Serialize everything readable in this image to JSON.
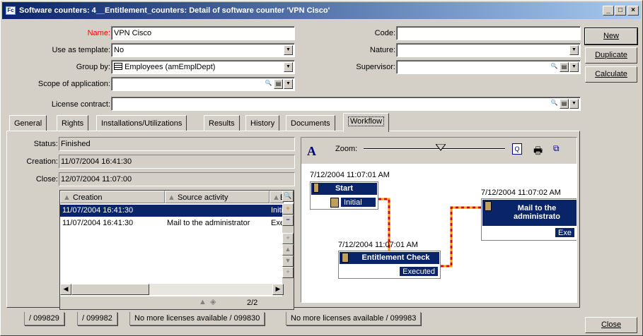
{
  "window": {
    "title": "Software counters: 4__Entitlement_counters: Detail of software counter 'VPN Cisco'",
    "app_icon": "Fc",
    "controls": [
      "_",
      "□",
      "×"
    ]
  },
  "form": {
    "name_label": "Name:",
    "name_value": "VPN Cisco",
    "use_template_label": "Use as template:",
    "use_template_value": "No",
    "group_by_label": "Group by:",
    "group_by_value": "Employees (amEmplDept)",
    "scope_label": "Scope of application:",
    "scope_value": "",
    "license_label": "License contract:",
    "license_value": "",
    "code_label": "Code:",
    "code_value": "",
    "nature_label": "Nature:",
    "nature_value": "",
    "supervisor_label": "Supervisor:",
    "supervisor_value": "",
    "name_label_color": "#ff0000"
  },
  "buttons": {
    "new": "New",
    "duplicate": "Duplicate",
    "calculate": "Calculate",
    "close": "Close"
  },
  "tabs": [
    "General",
    "Rights",
    "Installations/Utilizations",
    "Results",
    "History",
    "Documents",
    "Workflow"
  ],
  "active_tab": "Workflow",
  "workflow": {
    "status_label": "Status:",
    "status_value": "Finished",
    "creation_label": "Creation:",
    "creation_value": "11/07/2004 16:41:30",
    "close_label": "Close:",
    "close_value": "12/07/2004 11:07:00",
    "columns": [
      "Creation",
      "Source activity",
      "E"
    ],
    "rows": [
      {
        "creation": "11/07/2004 16:41:30",
        "source": "",
        "e": "Initi",
        "selected": true
      },
      {
        "creation": "11/07/2004 16:41:30",
        "source": "Mail to the administrator",
        "e": "Exe",
        "selected": false
      }
    ],
    "pager": "2/2",
    "zoom_label": "Zoom:",
    "zoom_level": 0.55,
    "text_tool": "A",
    "nodes": {
      "start": {
        "time": "7/12/2004 11:07:01 AM",
        "title": "Start",
        "status": "Initial"
      },
      "check": {
        "time": "7/12/2004 11:07:01 AM",
        "title": "Entitlement Check",
        "status": "Executed"
      },
      "mail": {
        "time": "7/12/2004 11:07:02 AM",
        "title": "Mail to the administrato",
        "status": "Exe"
      }
    },
    "link_color": "#ff9900",
    "link_dash_color": "#e00000"
  },
  "status_tabs": [
    "/ 099829",
    "/ 099982",
    "No more licenses available / 099830",
    "No more licenses available / 099983"
  ]
}
